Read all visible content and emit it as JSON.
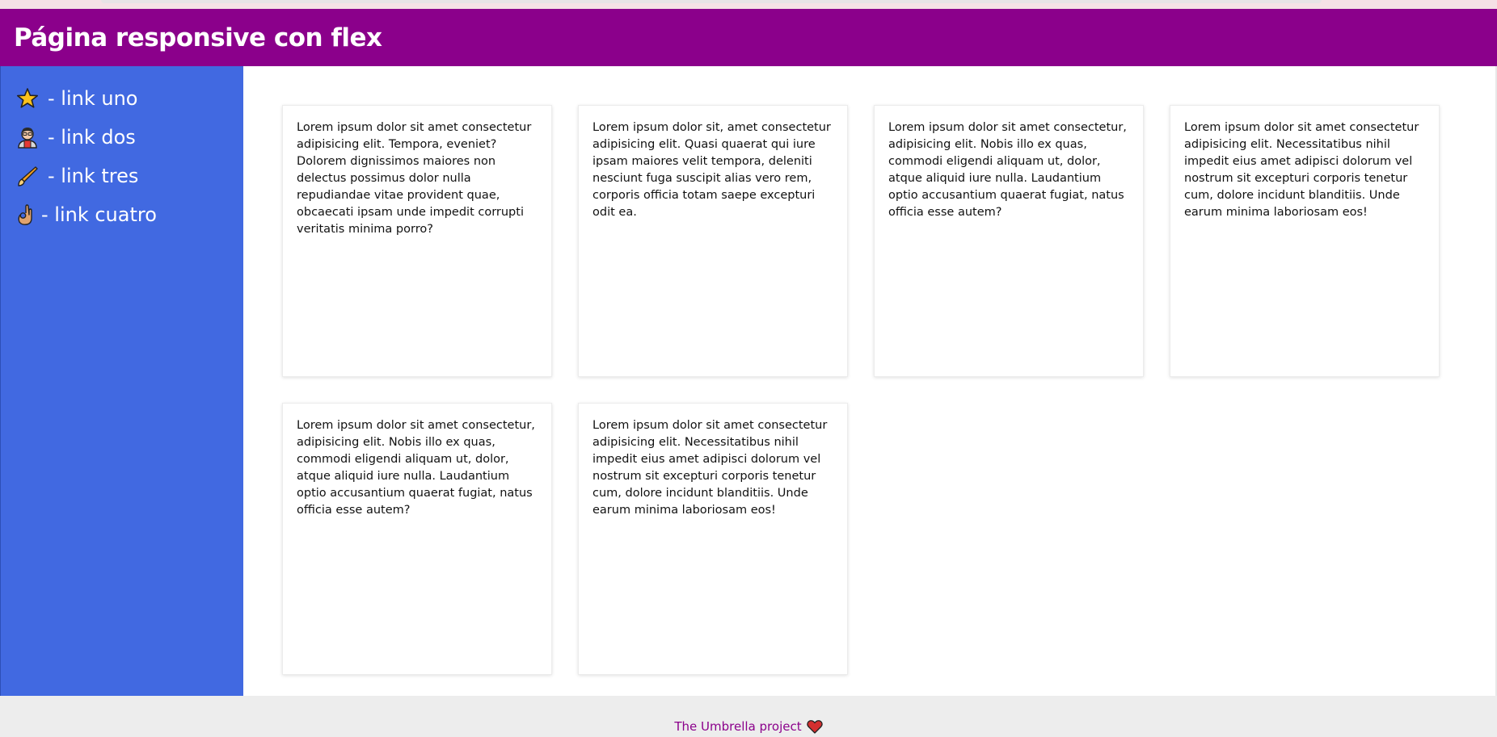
{
  "header": {
    "title": "Página responsive con flex"
  },
  "nav": {
    "items": [
      {
        "icon": "star-icon",
        "label": "- link uno"
      },
      {
        "icon": "person-icon",
        "label": "- link dos"
      },
      {
        "icon": "brush-icon",
        "label": "- link tres"
      },
      {
        "icon": "ok-hand-icon",
        "label": "- link cuatro"
      }
    ]
  },
  "cards": [
    {
      "text": "Lorem ipsum dolor sit amet consectetur adipisicing elit. Tempora, eveniet? Dolorem dignissimos maiores non delectus possimus dolor nulla repudiandae vitae provident quae, obcaecati ipsam unde impedit corrupti veritatis minima porro?"
    },
    {
      "text": "Lorem ipsum dolor sit, amet consectetur adipisicing elit. Quasi quaerat qui iure ipsam maiores velit tempora, deleniti nesciunt fuga suscipit alias vero rem, corporis officia totam saepe excepturi odit ea."
    },
    {
      "text": "Lorem ipsum dolor sit amet consectetur, adipisicing elit. Nobis illo ex quas, commodi eligendi aliquam ut, dolor, atque aliquid iure nulla. Laudantium optio accusantium quaerat fugiat, natus officia esse autem?"
    },
    {
      "text": "Lorem ipsum dolor sit amet consectetur adipisicing elit. Necessitatibus nihil impedit eius amet adipisci dolorum vel nostrum sit excepturi corporis tenetur cum, dolore incidunt blanditiis. Unde earum minima laboriosam eos!"
    },
    {
      "text": "Lorem ipsum dolor sit amet consectetur, adipisicing elit. Nobis illo ex quas, commodi eligendi aliquam ut, dolor, atque aliquid iure nulla. Laudantium optio accusantium quaerat fugiat, natus officia esse autem?"
    },
    {
      "text": "Lorem ipsum dolor sit amet consectetur adipisicing elit. Necessitatibus nihil impedit eius amet adipisci dolorum vel nostrum sit excepturi corporis tenetur cum, dolore incidunt blanditiis. Unde earum minima laboriosam eos!"
    }
  ],
  "footer": {
    "link_text": "The Umbrella project",
    "icon": "heart-icon"
  },
  "colors": {
    "header_bg": "#8b008b",
    "sidebar_bg": "#4169e1",
    "footer_bg": "#ededed",
    "footer_link": "#8b008b"
  }
}
